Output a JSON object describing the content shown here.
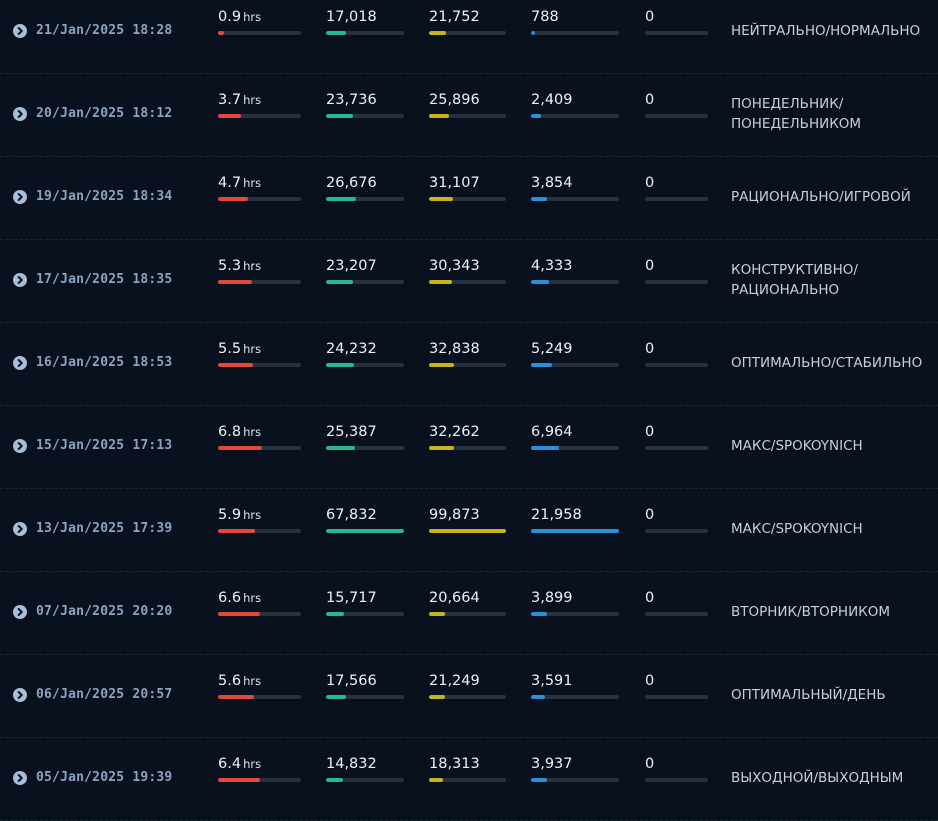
{
  "colors": {
    "hours_bar": "#e2483d",
    "col2_bar": "#26b890",
    "col3_bar": "#c6b51f",
    "col4_bar": "#2d8fd8",
    "bar_track": "#28323e"
  },
  "icons": {
    "expand": "chevron-right-circle-icon"
  },
  "hours_unit": "hrs",
  "rows": [
    {
      "date": "21/Jan/2025 18:28",
      "hours": "0.9",
      "hours_frac": 0.07,
      "c2": "17,018",
      "c2_frac": 0.25,
      "c3": "21,752",
      "c3_frac": 0.22,
      "c4": "788",
      "c4_frac": 0.04,
      "c5": "0",
      "c5_frac": 0,
      "label": "НЕЙТРАЛЬНО/НОРМАЛЬНО"
    },
    {
      "date": "20/Jan/2025 18:12",
      "hours": "3.7",
      "hours_frac": 0.28,
      "c2": "23,736",
      "c2_frac": 0.35,
      "c3": "25,896",
      "c3_frac": 0.26,
      "c4": "2,409",
      "c4_frac": 0.11,
      "c5": "0",
      "c5_frac": 0,
      "label": "ПОНЕДЕЛЬНИК/ ПОНЕДЕЛЬНИКОМ"
    },
    {
      "date": "19/Jan/2025 18:34",
      "hours": "4.7",
      "hours_frac": 0.36,
      "c2": "26,676",
      "c2_frac": 0.39,
      "c3": "31,107",
      "c3_frac": 0.31,
      "c4": "3,854",
      "c4_frac": 0.18,
      "c5": "0",
      "c5_frac": 0,
      "label": "РАЦИОНАЛЬНО/ИГРОВОЙ"
    },
    {
      "date": "17/Jan/2025 18:35",
      "hours": "5.3",
      "hours_frac": 0.41,
      "c2": "23,207",
      "c2_frac": 0.34,
      "c3": "30,343",
      "c3_frac": 0.3,
      "c4": "4,333",
      "c4_frac": 0.2,
      "c5": "0",
      "c5_frac": 0,
      "label": "КОНСТРУКТИВНО/ РАЦИОНАЛЬНО"
    },
    {
      "date": "16/Jan/2025 18:53",
      "hours": "5.5",
      "hours_frac": 0.42,
      "c2": "24,232",
      "c2_frac": 0.36,
      "c3": "32,838",
      "c3_frac": 0.33,
      "c4": "5,249",
      "c4_frac": 0.24,
      "c5": "0",
      "c5_frac": 0,
      "label": "ОПТИМАЛЬНО/СТАБИЛЬНО"
    },
    {
      "date": "15/Jan/2025 17:13",
      "hours": "6.8",
      "hours_frac": 0.53,
      "c2": "25,387",
      "c2_frac": 0.37,
      "c3": "32,262",
      "c3_frac": 0.32,
      "c4": "6,964",
      "c4_frac": 0.32,
      "c5": "0",
      "c5_frac": 0,
      "label": "МАКС/SPOKOYNICH"
    },
    {
      "date": "13/Jan/2025 17:39",
      "hours": "5.9",
      "hours_frac": 0.45,
      "c2": "67,832",
      "c2_frac": 1.0,
      "c3": "99,873",
      "c3_frac": 1.0,
      "c4": "21,958",
      "c4_frac": 1.0,
      "c5": "0",
      "c5_frac": 0,
      "label": "МАКС/SPOKOYNICH"
    },
    {
      "date": "07/Jan/2025 20:20",
      "hours": "6.6",
      "hours_frac": 0.51,
      "c2": "15,717",
      "c2_frac": 0.23,
      "c3": "20,664",
      "c3_frac": 0.21,
      "c4": "3,899",
      "c4_frac": 0.18,
      "c5": "0",
      "c5_frac": 0,
      "label": "ВТОРНИК/ВТОРНИКОМ"
    },
    {
      "date": "06/Jan/2025 20:57",
      "hours": "5.6",
      "hours_frac": 0.43,
      "c2": "17,566",
      "c2_frac": 0.26,
      "c3": "21,249",
      "c3_frac": 0.21,
      "c4": "3,591",
      "c4_frac": 0.16,
      "c5": "0",
      "c5_frac": 0,
      "label": "ОПТИМАЛЬНЫЙ/ДЕНЬ"
    },
    {
      "date": "05/Jan/2025 19:39",
      "hours": "6.4",
      "hours_frac": 0.5,
      "c2": "14,832",
      "c2_frac": 0.22,
      "c3": "18,313",
      "c3_frac": 0.18,
      "c4": "3,937",
      "c4_frac": 0.18,
      "c5": "0",
      "c5_frac": 0,
      "label": "ВЫХОДНОЙ/ВЫХОДНЫМ"
    }
  ]
}
